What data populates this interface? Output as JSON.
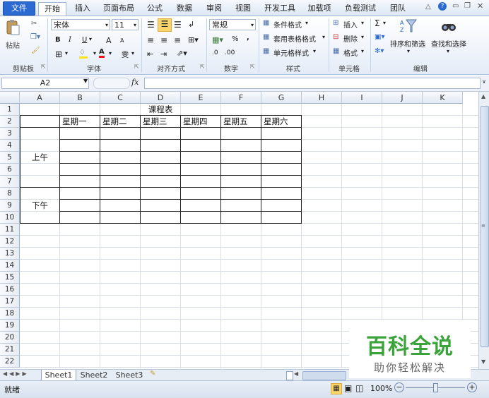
{
  "menubar": {
    "file": "文件",
    "tabs": [
      "开始",
      "插入",
      "页面布局",
      "公式",
      "数据",
      "审阅",
      "视图",
      "开发工具",
      "加载项",
      "负载测试",
      "团队"
    ]
  },
  "ribbon": {
    "clipboard": {
      "paste": "粘贴",
      "label": "剪贴板"
    },
    "font": {
      "name": "宋体",
      "size": "11",
      "bold": "B",
      "italic": "I",
      "underline": "U",
      "grow": "A",
      "shrink": "A",
      "label": "字体",
      "wen": "雯"
    },
    "alignment": {
      "label": "对齐方式"
    },
    "number": {
      "format": "常规",
      "percent": "%",
      "comma": ",",
      "label": "数字",
      "inc": ".0",
      "dec": ".00"
    },
    "styles": {
      "conditional": "条件格式",
      "table": "套用表格格式",
      "cell": "单元格样式",
      "label": "样式"
    },
    "cells": {
      "insert": "插入",
      "delete": "删除",
      "format": "格式",
      "label": "单元格"
    },
    "editing": {
      "sigma": "Σ",
      "sort": "排序和筛选",
      "find": "查找和选择",
      "label": "编辑"
    }
  },
  "formula_bar": {
    "name_box": "A2",
    "fx": "fx"
  },
  "columns": [
    "A",
    "B",
    "C",
    "D",
    "E",
    "F",
    "G",
    "H",
    "I",
    "J",
    "K"
  ],
  "rows": [
    "1",
    "2",
    "3",
    "4",
    "5",
    "6",
    "7",
    "8",
    "9",
    "10",
    "11",
    "12",
    "13",
    "14",
    "15",
    "16",
    "17",
    "18",
    "19",
    "20",
    "21",
    "22"
  ],
  "table": {
    "title": "课程表",
    "days": [
      "星期一",
      "星期二",
      "星期三",
      "星期四",
      "星期五",
      "星期六"
    ],
    "morning": "上午",
    "afternoon": "下午"
  },
  "sheets": [
    "Sheet1",
    "Sheet2",
    "Sheet3"
  ],
  "status": {
    "ready": "就绪",
    "zoom": "100%"
  },
  "watermark": {
    "title": "百科全说",
    "subtitle": "助你轻松解决"
  },
  "colors": {
    "accent": "#2b6bd1",
    "watermark": "#3aa33a"
  }
}
